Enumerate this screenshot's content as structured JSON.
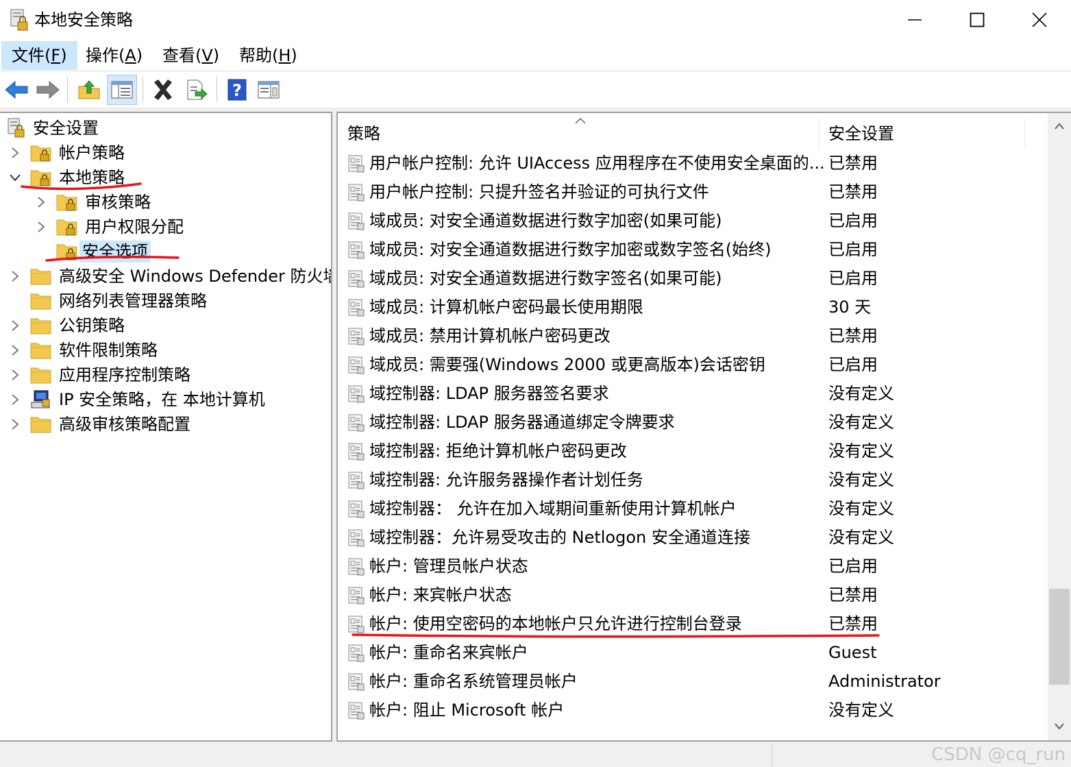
{
  "window": {
    "title": "本地安全策略"
  },
  "menu": [
    {
      "label": "文件(",
      "key": "F",
      "end": ")"
    },
    {
      "label": "操作(",
      "key": "A",
      "end": ")"
    },
    {
      "label": "查看(",
      "key": "V",
      "end": ")"
    },
    {
      "label": "帮助(",
      "key": "H",
      "end": ")"
    }
  ],
  "toolbar": {
    "buttons": [
      "back-icon",
      "forward-icon",
      "up-folder-icon",
      "show-hide-tree-icon",
      "delete-icon",
      "export-list-icon",
      "help-icon",
      "properties-view-icon"
    ]
  },
  "tree": {
    "items": [
      {
        "label": "安全设置",
        "icon": "security-settings-icon"
      },
      {
        "label": "帐户策略",
        "icon": "folder-lock-icon"
      },
      {
        "label": "本地策略",
        "icon": "folder-lock-icon"
      },
      {
        "label": "审核策略",
        "icon": "folder-lock-icon"
      },
      {
        "label": "用户权限分配",
        "icon": "folder-lock-icon"
      },
      {
        "label": "安全选项",
        "icon": "folder-lock-icon"
      },
      {
        "label": "高级安全 Windows Defender 防火墙",
        "icon": "folder-icon"
      },
      {
        "label": "网络列表管理器策略",
        "icon": "folder-icon"
      },
      {
        "label": "公钥策略",
        "icon": "folder-icon"
      },
      {
        "label": "软件限制策略",
        "icon": "folder-icon"
      },
      {
        "label": "应用程序控制策略",
        "icon": "folder-icon"
      },
      {
        "label": "IP 安全策略，在 本地计算机",
        "icon": "ip-security-icon"
      },
      {
        "label": "高级审核策略配置",
        "icon": "folder-icon"
      }
    ]
  },
  "list": {
    "columns": {
      "policy": "策略",
      "setting": "安全设置"
    },
    "rows": [
      {
        "policy": "用户帐户控制: 允许 UIAccess 应用程序在不使用安全桌面的...",
        "setting": "已禁用"
      },
      {
        "policy": "用户帐户控制: 只提升签名并验证的可执行文件",
        "setting": "已禁用"
      },
      {
        "policy": "域成员: 对安全通道数据进行数字加密(如果可能)",
        "setting": "已启用"
      },
      {
        "policy": "域成员: 对安全通道数据进行数字加密或数字签名(始终)",
        "setting": "已启用"
      },
      {
        "policy": "域成员: 对安全通道数据进行数字签名(如果可能)",
        "setting": "已启用"
      },
      {
        "policy": "域成员: 计算机帐户密码最长使用期限",
        "setting": "30 天"
      },
      {
        "policy": "域成员: 禁用计算机帐户密码更改",
        "setting": "已禁用"
      },
      {
        "policy": "域成员: 需要强(Windows 2000 或更高版本)会话密钥",
        "setting": "已启用"
      },
      {
        "policy": "域控制器: LDAP 服务器签名要求",
        "setting": "没有定义"
      },
      {
        "policy": "域控制器: LDAP 服务器通道绑定令牌要求",
        "setting": "没有定义"
      },
      {
        "policy": "域控制器: 拒绝计算机帐户密码更改",
        "setting": "没有定义"
      },
      {
        "policy": "域控制器: 允许服务器操作者计划任务",
        "setting": "没有定义"
      },
      {
        "policy": "域控制器： 允许在加入域期间重新使用计算机帐户",
        "setting": "没有定义"
      },
      {
        "policy": "域控制器：允许易受攻击的 Netlogon 安全通道连接",
        "setting": "没有定义"
      },
      {
        "policy": "帐户: 管理员帐户状态",
        "setting": "已启用"
      },
      {
        "policy": "帐户: 来宾帐户状态",
        "setting": "已禁用"
      },
      {
        "policy": "帐户: 使用空密码的本地帐户只允许进行控制台登录",
        "setting": "已禁用"
      },
      {
        "policy": "帐户: 重命名来宾帐户",
        "setting": "Guest"
      },
      {
        "policy": "帐户: 重命名系统管理员帐户",
        "setting": "Administrator"
      },
      {
        "policy": "帐户: 阻止 Microsoft 帐户",
        "setting": "没有定义"
      }
    ]
  },
  "scrollbar": {
    "position": 0.94
  },
  "watermark": "CSDN @cq_run",
  "colors": {
    "annotation": "#e8141b",
    "selection": "#cce8ff",
    "folder": "#f2c94c"
  }
}
